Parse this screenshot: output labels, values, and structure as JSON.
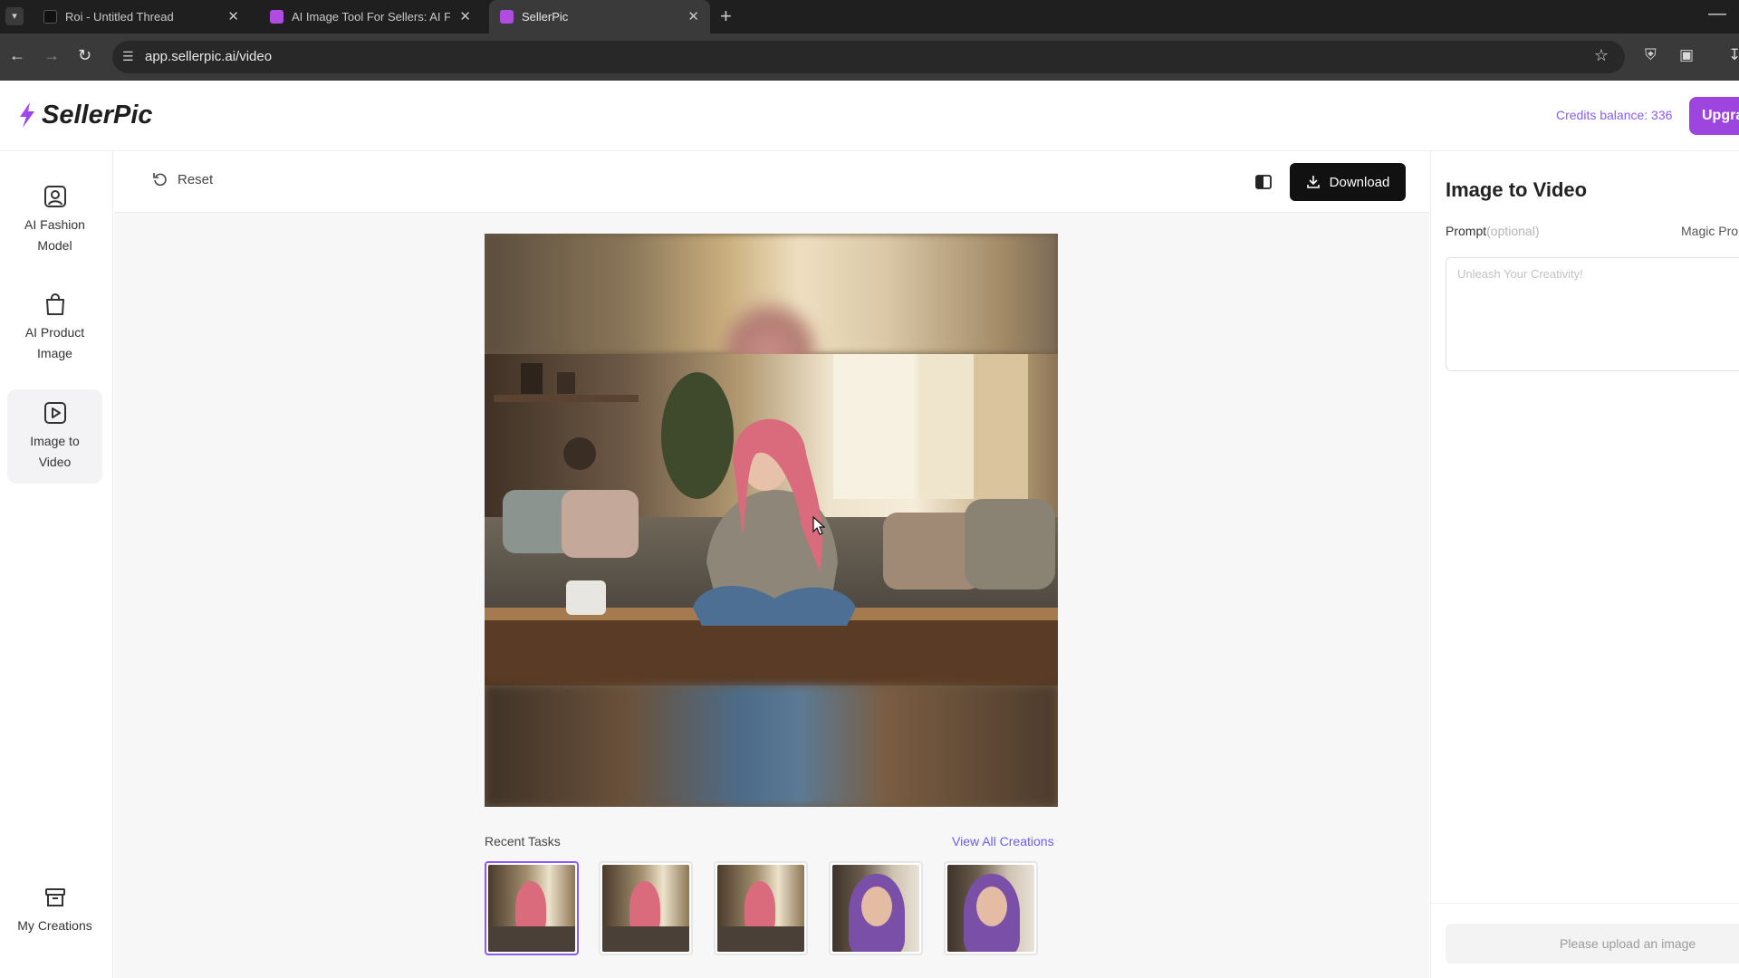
{
  "browser": {
    "tabs": [
      {
        "title": "Roi - Untitled Thread",
        "favicon_color": "#2a2a2a"
      },
      {
        "title": "AI Image Tool For Sellers: AI Fa",
        "favicon_color": "#b04de0"
      },
      {
        "title": "SellerPic",
        "favicon_color": "#b04de0",
        "active": true
      }
    ],
    "url": "app.sellerpic.ai/video"
  },
  "header": {
    "logo_text": "SellerPic",
    "credits": "Credits balance: 336",
    "upgrade_label": "Upgra"
  },
  "sidebar": {
    "items": [
      {
        "label_line1": "AI Fashion",
        "label_line2": "Model",
        "icon": "user-square-icon"
      },
      {
        "label_line1": "AI Product",
        "label_line2": "Image",
        "icon": "shopping-bag-icon"
      },
      {
        "label_line1": "Image to",
        "label_line2": "Video",
        "icon": "play-square-icon",
        "active": true
      },
      {
        "label_line1": "My Creations",
        "icon": "archive-icon"
      }
    ]
  },
  "toolbar": {
    "reset_label": "Reset",
    "download_label": "Download"
  },
  "recent": {
    "title": "Recent Tasks",
    "view_all": "View All Creations",
    "thumbs": [
      {
        "palette": "pink-hair",
        "selected": true
      },
      {
        "palette": "pink-hair"
      },
      {
        "palette": "pink-hair"
      },
      {
        "palette": "purple-hair"
      },
      {
        "palette": "purple-hair"
      }
    ]
  },
  "panel": {
    "title": "Image to Video",
    "prompt_label": "Prompt",
    "prompt_optional": "(optional)",
    "magic_label": "Magic Pro",
    "prompt_placeholder": "Unleash Your Creativity!",
    "upload_hint": "Please upload an image"
  },
  "colors": {
    "accent": "#8a5cf6",
    "upgrade": "#9e45e0",
    "download_bg": "#111111"
  }
}
